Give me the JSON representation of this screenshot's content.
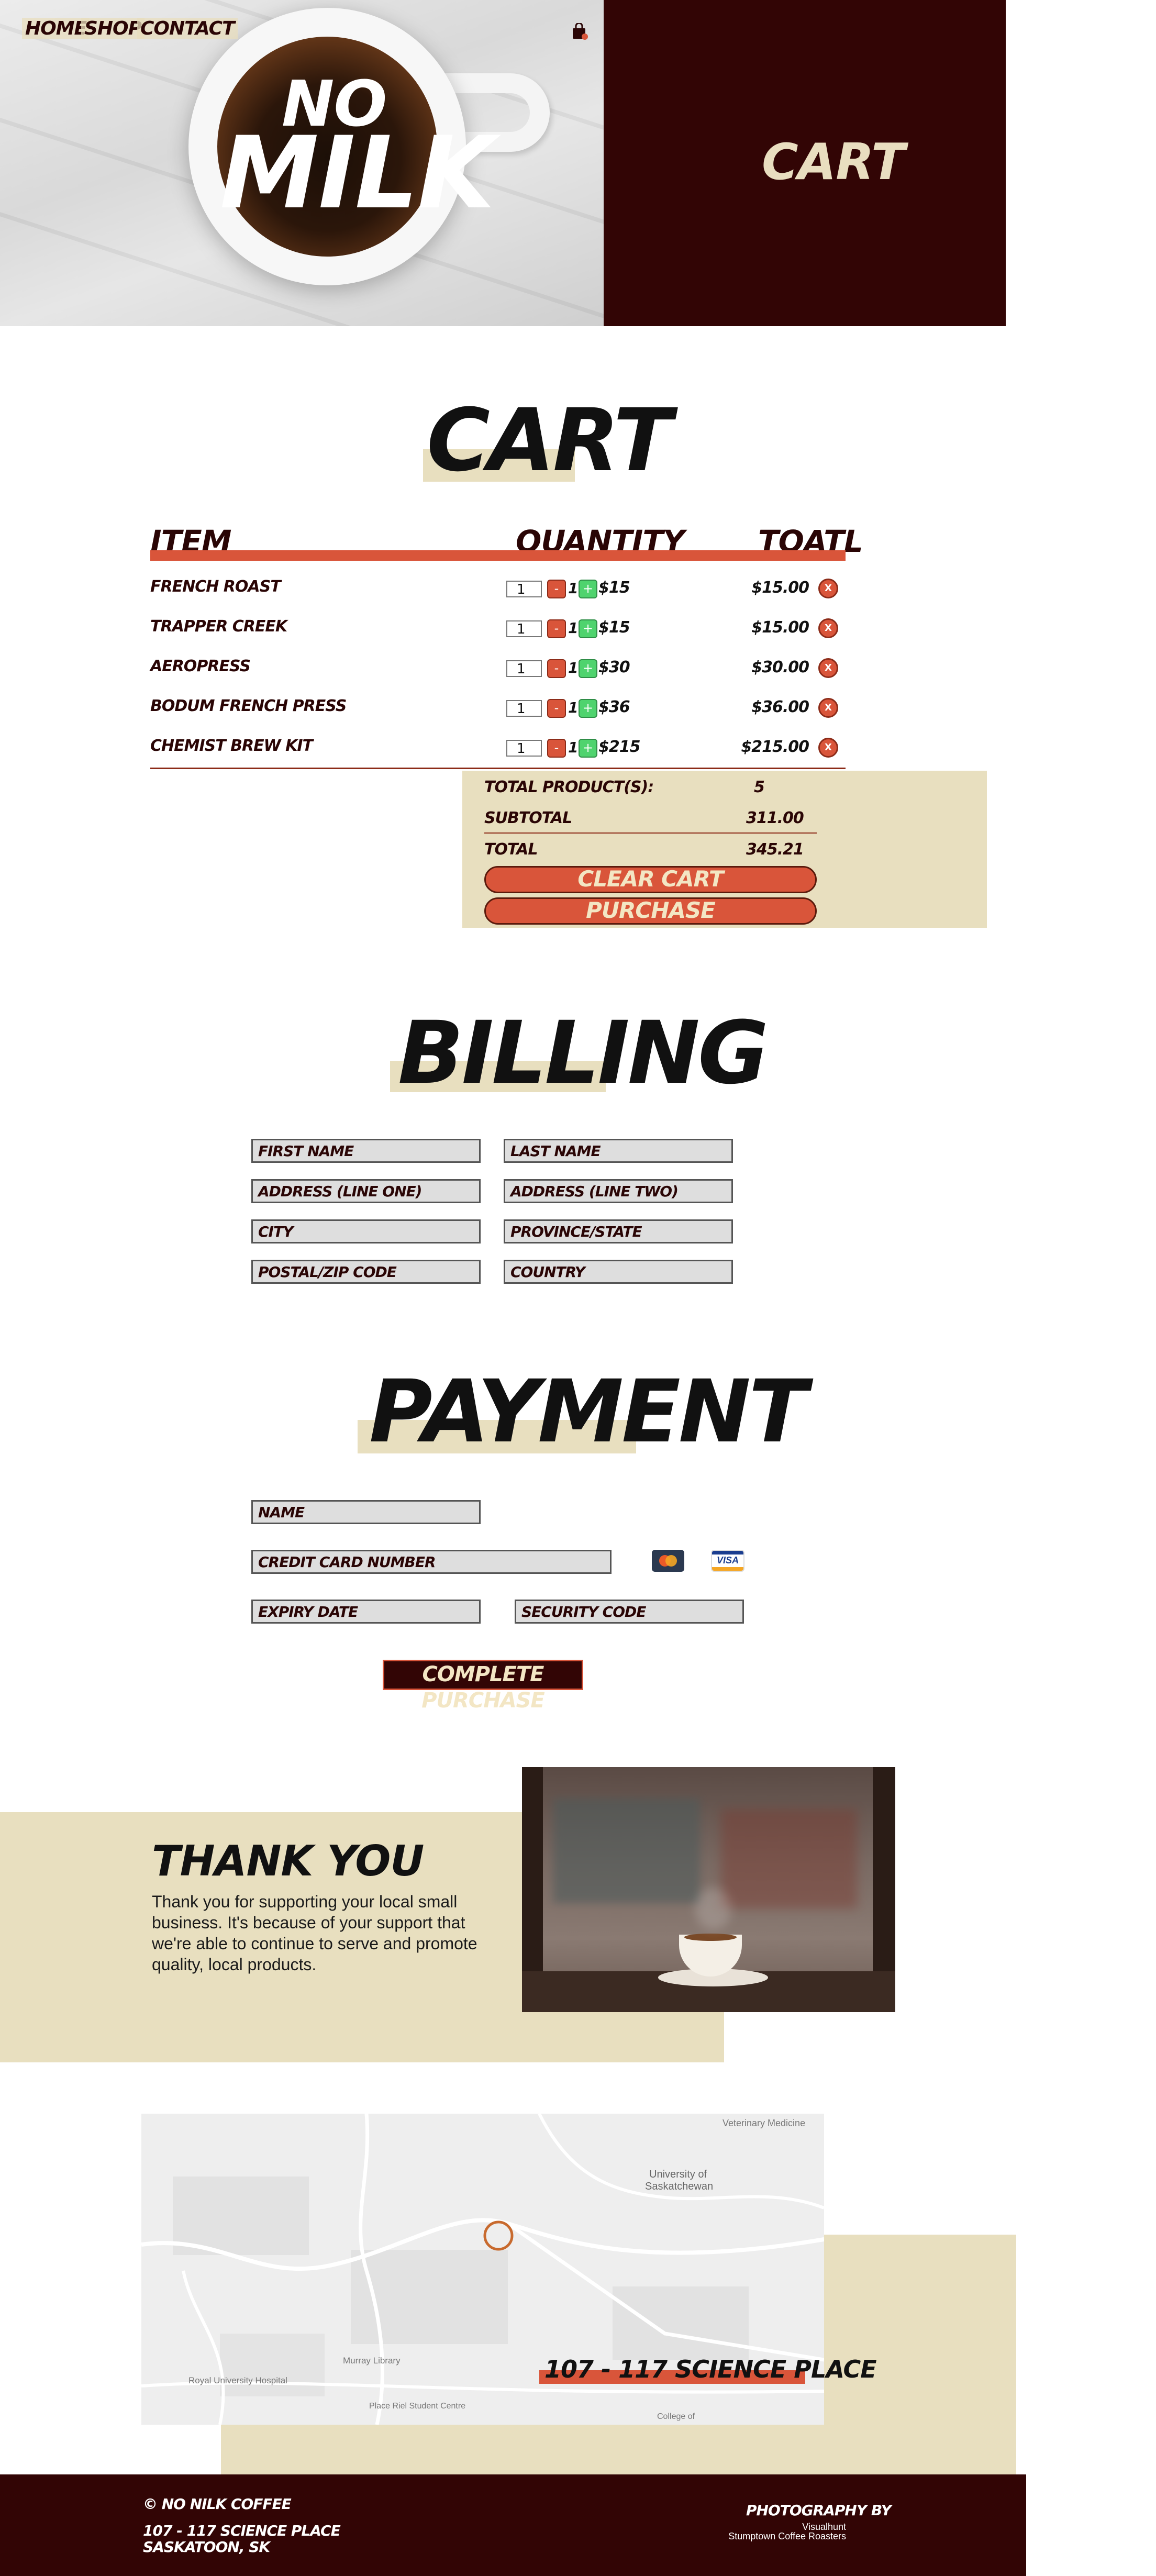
{
  "nav": {
    "home": "HOME",
    "shop": "SHOP",
    "contact": "CONTACT"
  },
  "hero": {
    "logo_top": "NO",
    "logo_bottom": "MILK",
    "panel_title": "CART"
  },
  "cart": {
    "title": "CART",
    "headers": {
      "item": "ITEM",
      "quantity": "QUANTITY",
      "total": "TOATL"
    },
    "items": [
      {
        "name": "FRENCH ROAST",
        "qty": "1",
        "count": "1",
        "unit": "$15",
        "total": "$15.00"
      },
      {
        "name": "TRAPPER CREEK",
        "qty": "1",
        "count": "1",
        "unit": "$15",
        "total": "$15.00"
      },
      {
        "name": "AEROPRESS",
        "qty": "1",
        "count": "1",
        "unit": "$30",
        "total": "$30.00"
      },
      {
        "name": "BODUM FRENCH PRESS",
        "qty": "1",
        "count": "1",
        "unit": "$36",
        "total": "$36.00"
      },
      {
        "name": "CHEMIST BREW KIT",
        "qty": "1",
        "count": "1",
        "unit": "$215",
        "total": "$215.00"
      }
    ],
    "minus": "-",
    "plus": "+",
    "remove": "X",
    "summary": {
      "products_label": "TOTAL PRODUCT(S):",
      "products_value": "5",
      "subtotal_label": "SUBTOTAL",
      "subtotal_value": "311.00",
      "total_label": "TOTAL",
      "total_value": "345.21"
    },
    "clear_label": "CLEAR CART",
    "purchase_label": "PURCHASE"
  },
  "billing": {
    "title": "BILLING",
    "first_name": "FIRST NAME",
    "last_name": "LAST NAME",
    "address1": "ADDRESS (LINE ONE)",
    "address2": "ADDRESS (LINE TWO)",
    "city": "CITY",
    "province": "PROVINCE/STATE",
    "postal": "POSTAL/ZIP CODE",
    "country": "COUNTRY"
  },
  "payment": {
    "title": "PAYMENT",
    "name": "NAME",
    "card": "CREDIT CARD NUMBER",
    "expiry": "EXPIRY DATE",
    "security": "SECURITY CODE",
    "visa": "VISA",
    "complete_label": "COMPLETE PURCHASE"
  },
  "thanks": {
    "title": "THANK YOU",
    "text": "Thank you for supporting your local small business. It's because of your support that we're able to continue to serve and promote quality, local products."
  },
  "map": {
    "address": "107 - 117 SCIENCE PLACE",
    "labels": {
      "vet": "Veterinary Medicine",
      "usask1": "University of",
      "usask2": "Saskatchewan",
      "hospital": "Royal University Hospital",
      "library": "Murray Library",
      "student": "Place Riel Student Centre",
      "college": "College of"
    }
  },
  "footer": {
    "copyright": "© NO NILK COFFEE",
    "address1": "107 - 117 SCIENCE PLACE",
    "address2": "SASKATOON, SK",
    "photo_by": "PHOTOGRAPHY BY",
    "credit1": "Visualhunt",
    "credit2": "Stumptown Coffee Roasters"
  },
  "colors": {
    "maroon": "#320505",
    "orange": "#d9553a",
    "beige": "#e8dfbf",
    "green": "#4fd36e"
  }
}
